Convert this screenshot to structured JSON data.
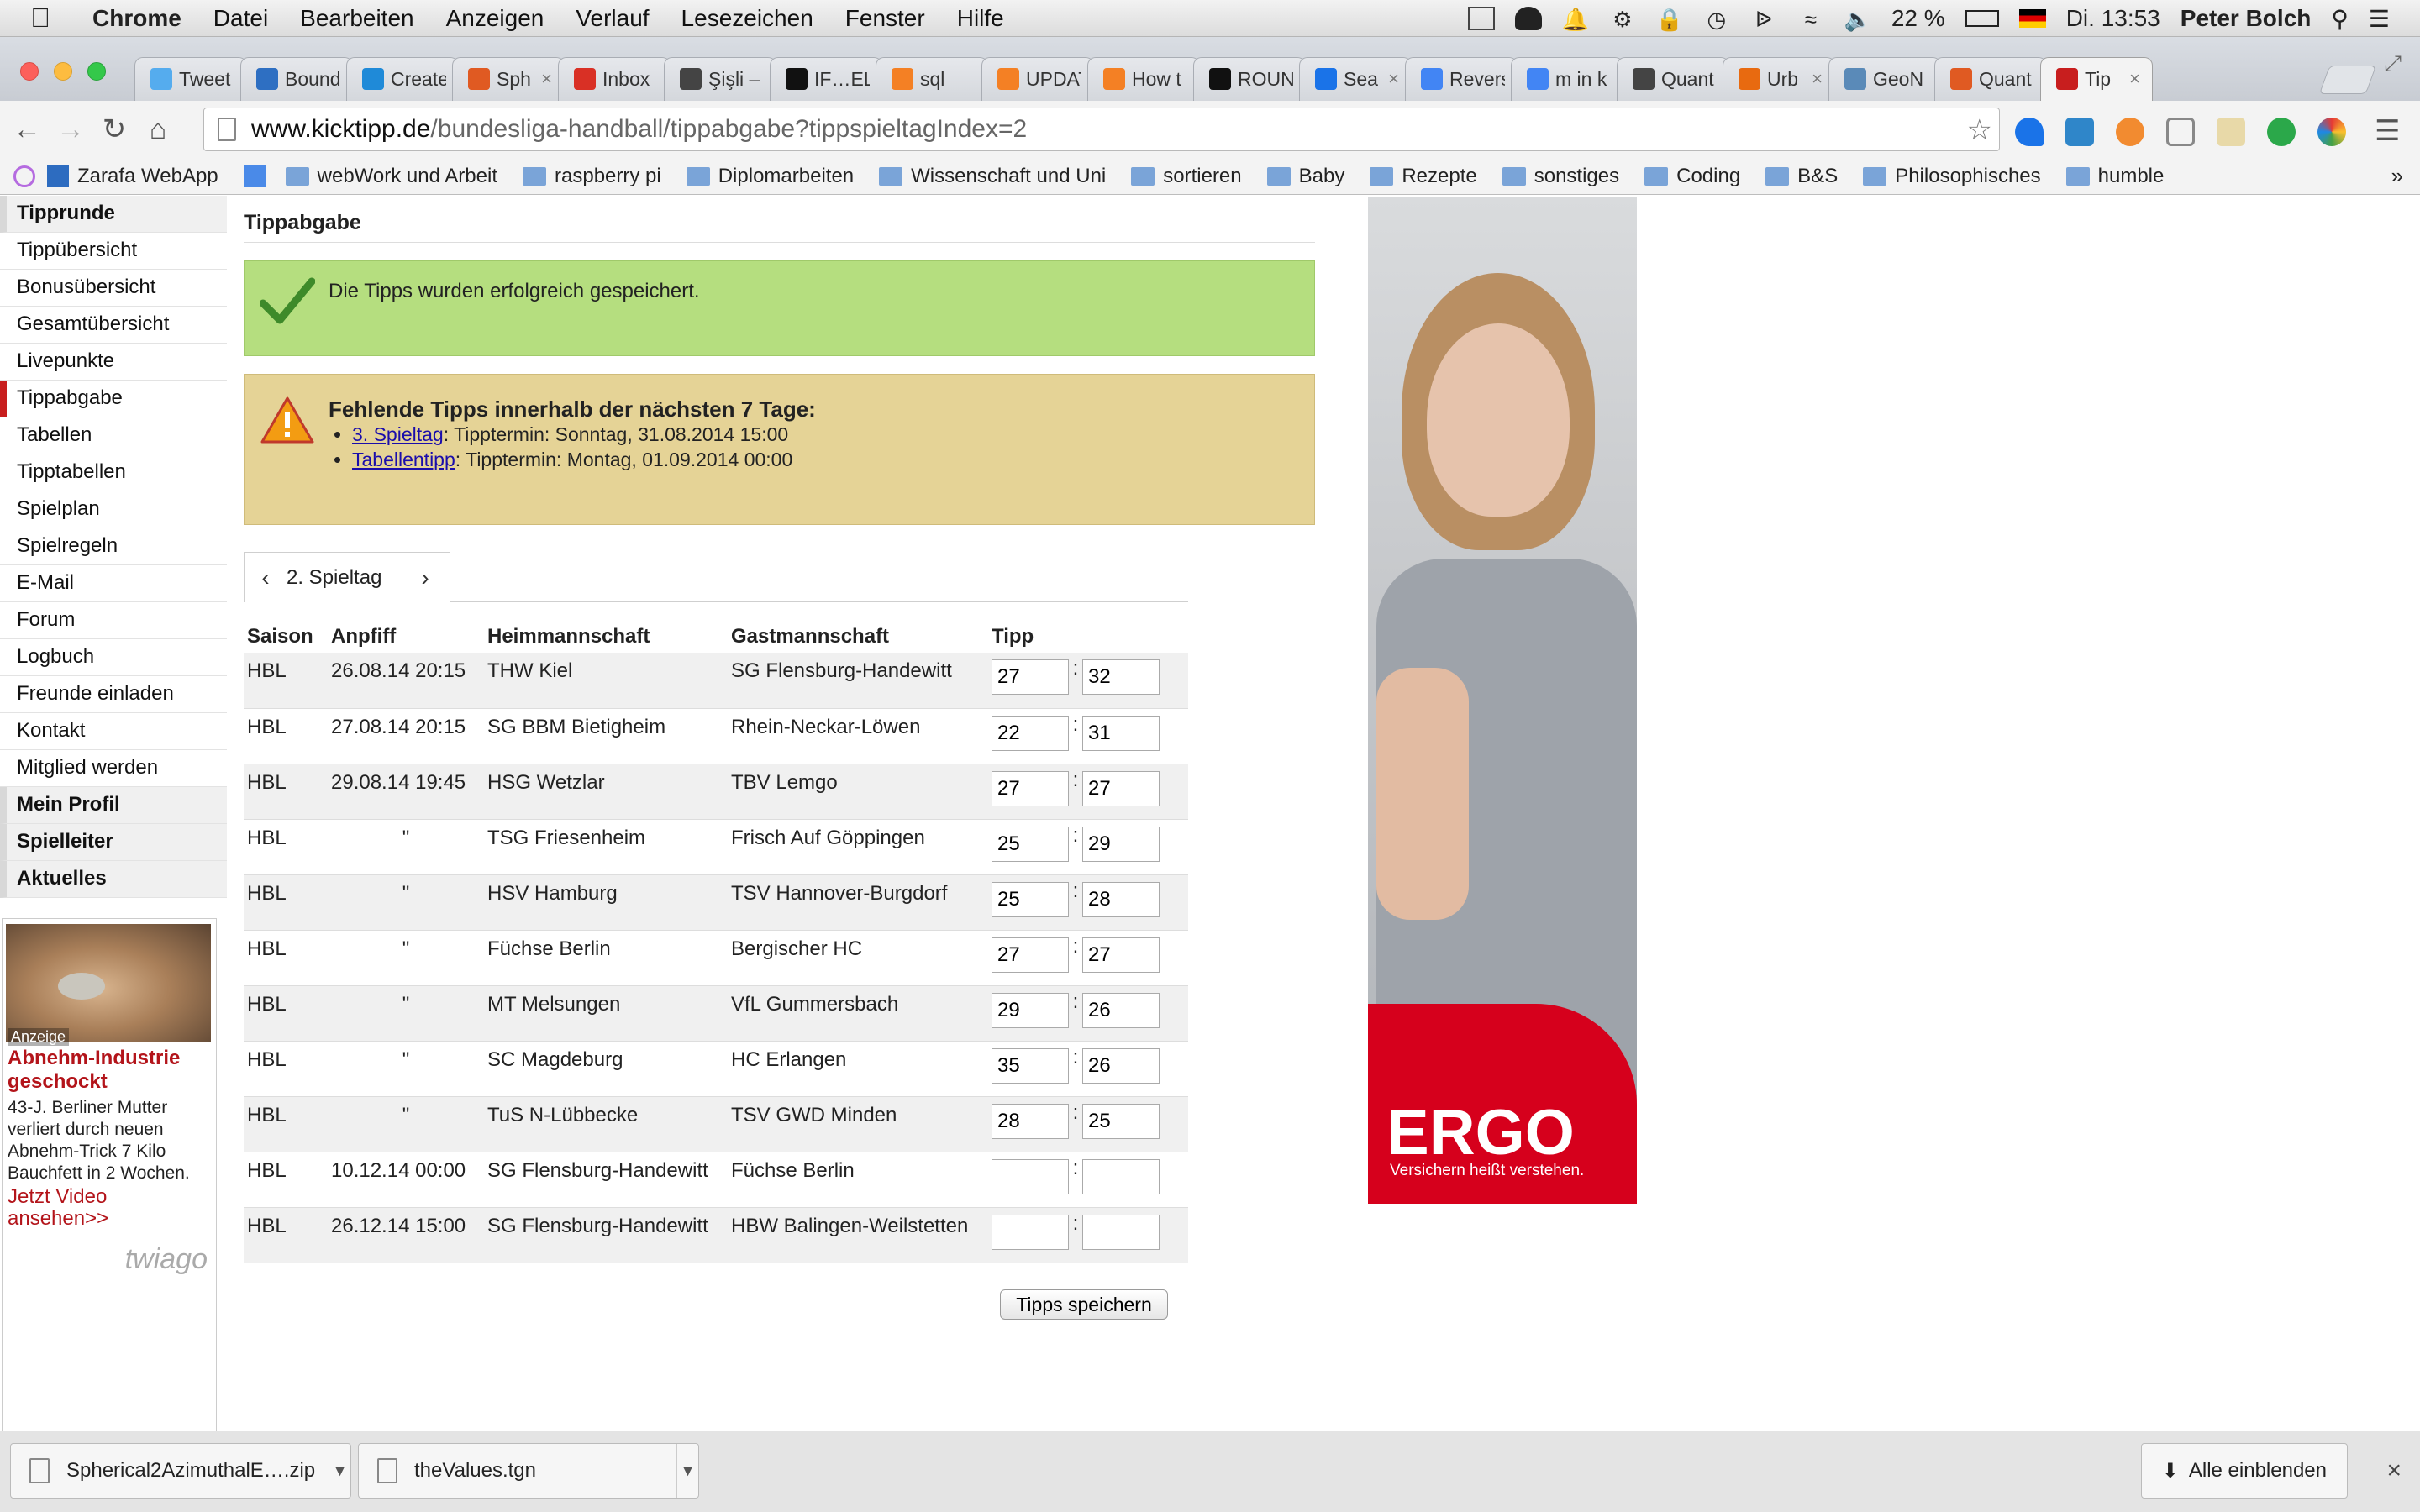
{
  "menubar": {
    "app": "Chrome",
    "items": [
      "Datei",
      "Bearbeiten",
      "Anzeigen",
      "Verlauf",
      "Lesezeichen",
      "Fenster",
      "Hilfe"
    ],
    "battery": "22 %",
    "clock": "Di. 13:53",
    "user": "Peter Bolch"
  },
  "tabs": [
    {
      "label": "Tweet",
      "icon_color": "#55acee"
    },
    {
      "label": "Bound",
      "icon_color": "#2e6fc2"
    },
    {
      "label": "Create",
      "icon_color": "#1f8ad8"
    },
    {
      "label": "Sph",
      "icon_color": "#e05a22"
    },
    {
      "label": "Inbox",
      "icon_color": "#d93025"
    },
    {
      "label": "Şişli –",
      "icon_color": "#444444"
    },
    {
      "label": "IF…EL",
      "icon_color": "#111111"
    },
    {
      "label": "sql",
      "icon_color": "#f48024"
    },
    {
      "label": "UPDAT",
      "icon_color": "#f48024"
    },
    {
      "label": "How t",
      "icon_color": "#f48024"
    },
    {
      "label": "ROUN",
      "icon_color": "#111111"
    },
    {
      "label": "Sea",
      "icon_color": "#1a73e8"
    },
    {
      "label": "Revers",
      "icon_color": "#4285f4"
    },
    {
      "label": "m in k",
      "icon_color": "#4285f4"
    },
    {
      "label": "Quant",
      "icon_color": "#444444"
    },
    {
      "label": "Urb",
      "icon_color": "#e86a10"
    },
    {
      "label": "GeoN",
      "icon_color": "#5a8ab8"
    },
    {
      "label": "Quant",
      "icon_color": "#e05a22"
    },
    {
      "label": "Tip",
      "icon_color": "#c81e1e"
    }
  ],
  "omnibox": {
    "host": "www.kicktipp.de",
    "path": "/bundesliga-handball/tippabgabe?tippspieltagIndex=2"
  },
  "bookmarks": [
    "Zarafa WebApp",
    "webWork und Arbeit",
    "raspberry pi",
    "Diplomarbeiten",
    "Wissenschaft und Uni",
    "sortieren",
    "Baby",
    "Rezepte",
    "sonstiges",
    "Coding",
    "B&S",
    "Philosophisches",
    "humble"
  ],
  "sidebar": {
    "items": [
      {
        "label": "Tipprunde",
        "head": true
      },
      {
        "label": "Tippübersicht"
      },
      {
        "label": "Bonusübersicht"
      },
      {
        "label": "Gesamtübersicht"
      },
      {
        "label": "Livepunkte"
      },
      {
        "label": "Tippabgabe",
        "active": true
      },
      {
        "label": "Tabellen"
      },
      {
        "label": "Tipptabellen"
      },
      {
        "label": "Spielplan"
      },
      {
        "label": "Spielregeln"
      },
      {
        "label": "E-Mail"
      },
      {
        "label": "Forum"
      },
      {
        "label": "Logbuch"
      },
      {
        "label": "Freunde einladen"
      },
      {
        "label": "Kontakt"
      },
      {
        "label": "Mitglied werden"
      },
      {
        "label": "Mein Profil",
        "head": true
      },
      {
        "label": "Spielleiter",
        "head": true
      },
      {
        "label": "Aktuelles",
        "head": true
      }
    ],
    "ad": {
      "tag": "Anzeige",
      "headline": "Abnehm-Industrie geschockt",
      "text": "43-J. Berliner Mutter verliert durch neuen Abnehm-Trick 7 Kilo Bauchfett in 2 Wochen.",
      "cta": "Jetzt Video ansehen>>",
      "brand": "twiago"
    }
  },
  "main": {
    "title": "Tippabgabe",
    "success": "Die Tipps wurden erfolgreich gespeichert.",
    "warning": {
      "title": "Fehlende Tipps innerhalb der nächsten 7 Tage:",
      "items": [
        {
          "link": "3. Spieltag",
          "rest": ": Tipptermin: Sonntag, 31.08.2014 15:00"
        },
        {
          "link": "Tabellentipp",
          "rest": ": Tipptermin: Montag, 01.09.2014 00:00"
        }
      ]
    },
    "matchday": "2. Spieltag",
    "headers": [
      "Saison",
      "Anpfiff",
      "Heimmannschaft",
      "Gastmannschaft",
      "Tipp"
    ],
    "matches": [
      {
        "season": "HBL",
        "kickoff": "26.08.14 20:15",
        "home": "THW Kiel",
        "away": "SG Flensburg-Handewitt",
        "h": "27",
        "a": "32"
      },
      {
        "season": "HBL",
        "kickoff": "27.08.14 20:15",
        "home": "SG BBM Bietigheim",
        "away": "Rhein-Neckar-Löwen",
        "h": "22",
        "a": "31"
      },
      {
        "season": "HBL",
        "kickoff": "29.08.14 19:45",
        "home": "HSG Wetzlar",
        "away": "TBV Lemgo",
        "h": "27",
        "a": "27"
      },
      {
        "season": "HBL",
        "kickoff": "\"",
        "home": "TSG Friesenheim",
        "away": "Frisch Auf Göppingen",
        "h": "25",
        "a": "29"
      },
      {
        "season": "HBL",
        "kickoff": "\"",
        "home": "HSV Hamburg",
        "away": "TSV Hannover-Burgdorf",
        "h": "25",
        "a": "28"
      },
      {
        "season": "HBL",
        "kickoff": "\"",
        "home": "Füchse Berlin",
        "away": "Bergischer HC",
        "h": "27",
        "a": "27"
      },
      {
        "season": "HBL",
        "kickoff": "\"",
        "home": "MT Melsungen",
        "away": "VfL Gummersbach",
        "h": "29",
        "a": "26"
      },
      {
        "season": "HBL",
        "kickoff": "\"",
        "home": "SC Magdeburg",
        "away": "HC Erlangen",
        "h": "35",
        "a": "26"
      },
      {
        "season": "HBL",
        "kickoff": "\"",
        "home": "TuS N-Lübbecke",
        "away": "TSV GWD Minden",
        "h": "28",
        "a": "25"
      },
      {
        "season": "HBL",
        "kickoff": "10.12.14 00:00",
        "home": "SG Flensburg-Handewitt",
        "away": "Füchse Berlin",
        "h": "",
        "a": ""
      },
      {
        "season": "HBL",
        "kickoff": "26.12.14 15:00",
        "home": "SG Flensburg-Handewitt",
        "away": "HBW Balingen-Weilstetten",
        "h": "",
        "a": ""
      }
    ],
    "save_label": "Tipps speichern"
  },
  "banner": {
    "logo": "ERGO",
    "claim": "Versichern heißt verstehen."
  },
  "downloads": {
    "items": [
      "Spherical2AzimuthalE….zip",
      "theValues.tgn"
    ],
    "show_all": "Alle einblenden"
  }
}
